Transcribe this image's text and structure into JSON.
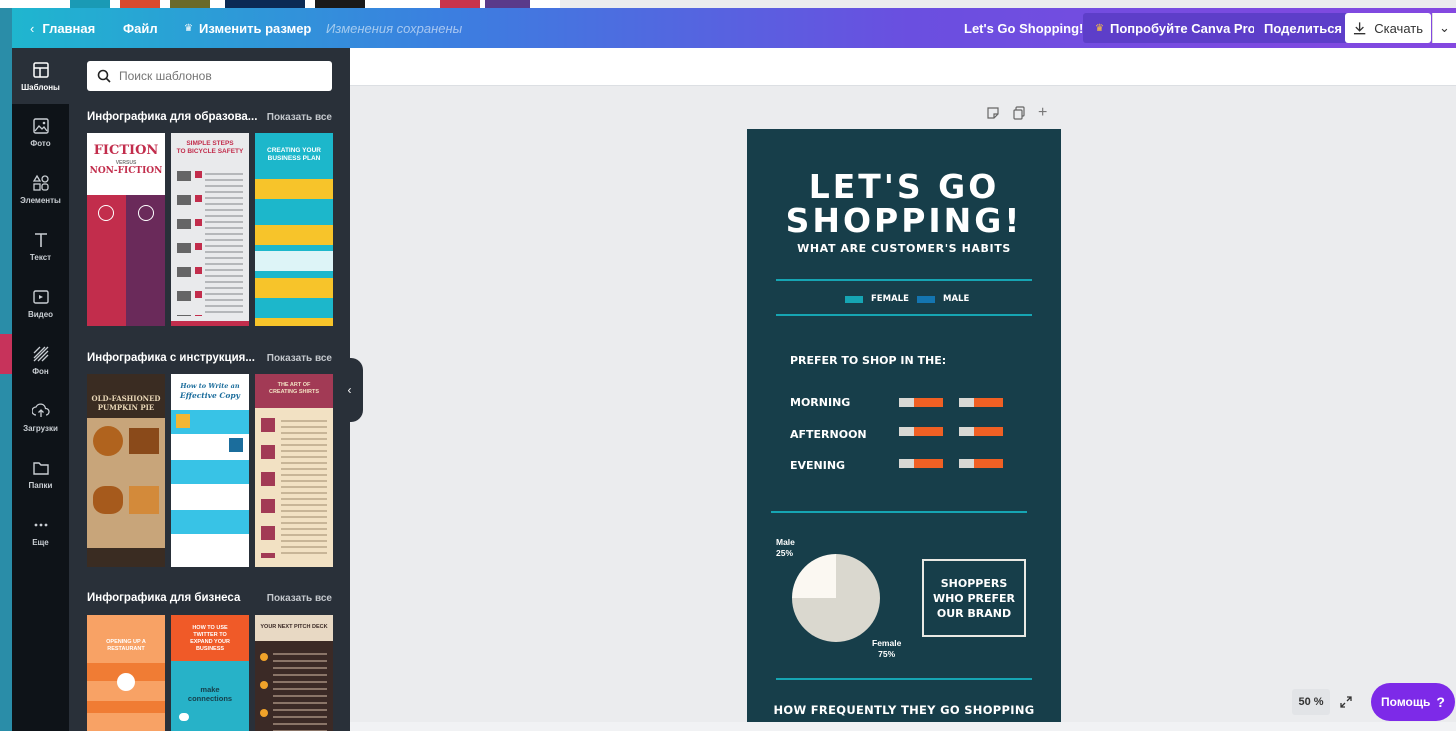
{
  "header": {
    "back_label": "Главная",
    "file_label": "Файл",
    "resize_label": "Изменить размер",
    "saved_status": "Изменения сохранены",
    "design_title": "Let's Go Shopping!",
    "pro_label": "Попробуйте Canva Pro",
    "share_label": "Поделиться",
    "download_label": "Скачать"
  },
  "rail": {
    "items": [
      {
        "label": "Шаблоны",
        "icon": "templates-icon"
      },
      {
        "label": "Фото",
        "icon": "photo-icon"
      },
      {
        "label": "Элементы",
        "icon": "elements-icon"
      },
      {
        "label": "Текст",
        "icon": "text-icon"
      },
      {
        "label": "Видео",
        "icon": "video-icon"
      },
      {
        "label": "Фон",
        "icon": "background-icon"
      },
      {
        "label": "Загрузки",
        "icon": "upload-icon"
      },
      {
        "label": "Папки",
        "icon": "folder-icon"
      },
      {
        "label": "Еще",
        "icon": "more-icon"
      }
    ]
  },
  "panel": {
    "search_placeholder": "Поиск шаблонов",
    "sections": [
      {
        "title": "Инфографика для образова...",
        "show_all": "Показать все",
        "templates": [
          {
            "line1": "FICTION",
            "line2": "VERSUS",
            "line3": "NON-FICTION"
          },
          {
            "line1": "SIMPLE STEPS",
            "line2": "TO BICYCLE SAFETY"
          },
          {
            "line1": "CREATING YOUR",
            "line2": "BUSINESS PLAN"
          }
        ]
      },
      {
        "title": "Инфографика с инструкция...",
        "show_all": "Показать все",
        "templates": [
          {
            "line1": "OLD-FASHIONED",
            "line2": "PUMPKIN PIE"
          },
          {
            "line1": "How to Write an",
            "line2": "Effective Copy"
          },
          {
            "line1": "THE ART OF",
            "line2": "CREATING SHIRTS"
          }
        ]
      },
      {
        "title": "Инфографика для бизнеса",
        "show_all": "Показать все",
        "templates": [
          {
            "line1": "OPENING UP A",
            "line2": "RESTAURANT"
          },
          {
            "line1": "HOW TO USE",
            "line2": "TWITTER TO",
            "line3": "EXPAND YOUR",
            "line4": "BUSINESS",
            "line5": "make",
            "line6": "connections"
          },
          {
            "line1": "YOUR NEXT PITCH DECK"
          }
        ]
      }
    ]
  },
  "design": {
    "title_line1": "LET'S GO",
    "title_line2": "SHOPPING!",
    "subtitle": "WHAT ARE CUSTOMER'S HABITS",
    "legend": [
      {
        "label": "FEMALE",
        "color": "#16a5b3"
      },
      {
        "label": "MALE",
        "color": "#1475b0"
      }
    ],
    "prefer_heading": "PREFER TO SHOP IN THE:",
    "times": [
      {
        "label": "MORNING",
        "female_share": 0.35,
        "male_share": 0.35
      },
      {
        "label": "AFTERNOON",
        "female_share": 0.35,
        "male_share": 0.35
      },
      {
        "label": "EVENING",
        "female_share": 0.35,
        "male_share": 0.35
      }
    ],
    "pie": {
      "male_label": "Male",
      "male_pct": "25%",
      "female_label": "Female",
      "female_pct": "75%",
      "male_value": 25,
      "female_value": 75
    },
    "brand_box": "SHOPPERS WHO PREFER OUR BRAND",
    "footer_heading": "HOW FREQUENTLY THEY GO SHOPPING"
  },
  "zoom": "50 %",
  "help_label": "Помощь"
}
